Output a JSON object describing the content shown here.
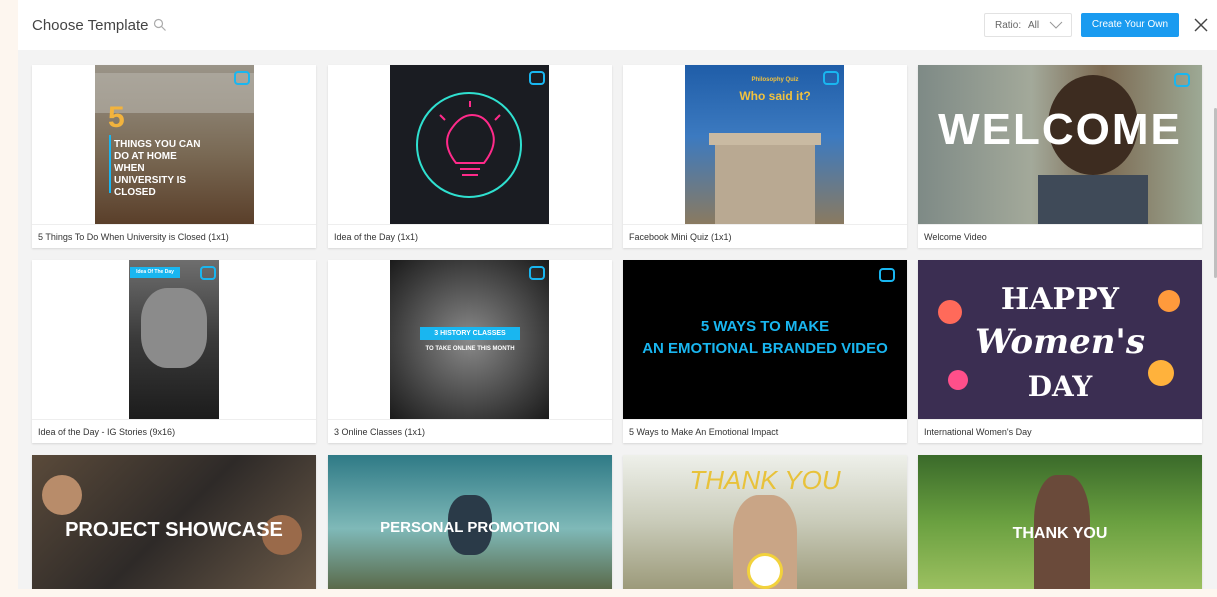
{
  "header": {
    "title": "Choose Template",
    "ratio_label": "Ratio:",
    "ratio_value": "All",
    "create_label": "Create Your Own"
  },
  "icons": {
    "search": "search-icon",
    "close": "close-icon",
    "dropdown": "chevron-down-icon",
    "brand": "brand-logo-icon"
  },
  "colors": {
    "accent": "#1a9bf0",
    "brand_cyan": "#19b6f0"
  },
  "templates": [
    {
      "caption": "5 Things To Do When University is Closed (1x1)",
      "thumb_text": [
        "5",
        "THINGS YOU CAN",
        "DO AT HOME",
        "WHEN",
        "UNIVERSITY IS",
        "CLOSED"
      ]
    },
    {
      "caption": "Idea of the Day (1x1)"
    },
    {
      "caption": "Facebook Mini Quiz (1x1)",
      "thumb_text": [
        "Philosophy Quiz",
        "Who said it?"
      ]
    },
    {
      "caption": "Welcome Video",
      "thumb_text": [
        "WELCOME"
      ]
    },
    {
      "caption": "Idea of the Day - IG Stories (9x16)",
      "thumb_text": [
        "Idea Of The Day"
      ]
    },
    {
      "caption": "3 Online Classes (1x1)",
      "thumb_text": [
        "3 HISTORY CLASSES",
        "TO TAKE ONLINE THIS MONTH"
      ]
    },
    {
      "caption": "5 Ways to Make An Emotional Impact",
      "thumb_text": [
        "5 WAYS TO MAKE",
        "AN EMOTIONAL BRANDED VIDEO"
      ]
    },
    {
      "caption": "International Women's Day",
      "thumb_text": [
        "HAPPY",
        "Women's",
        "DAY"
      ]
    },
    {
      "thumb_text": [
        "PROJECT SHOWCASE"
      ]
    },
    {
      "thumb_text": [
        "PERSONAL PROMOTION"
      ]
    },
    {
      "thumb_text": [
        "THANK YOU"
      ]
    },
    {
      "thumb_text": [
        "THANK YOU"
      ]
    }
  ]
}
